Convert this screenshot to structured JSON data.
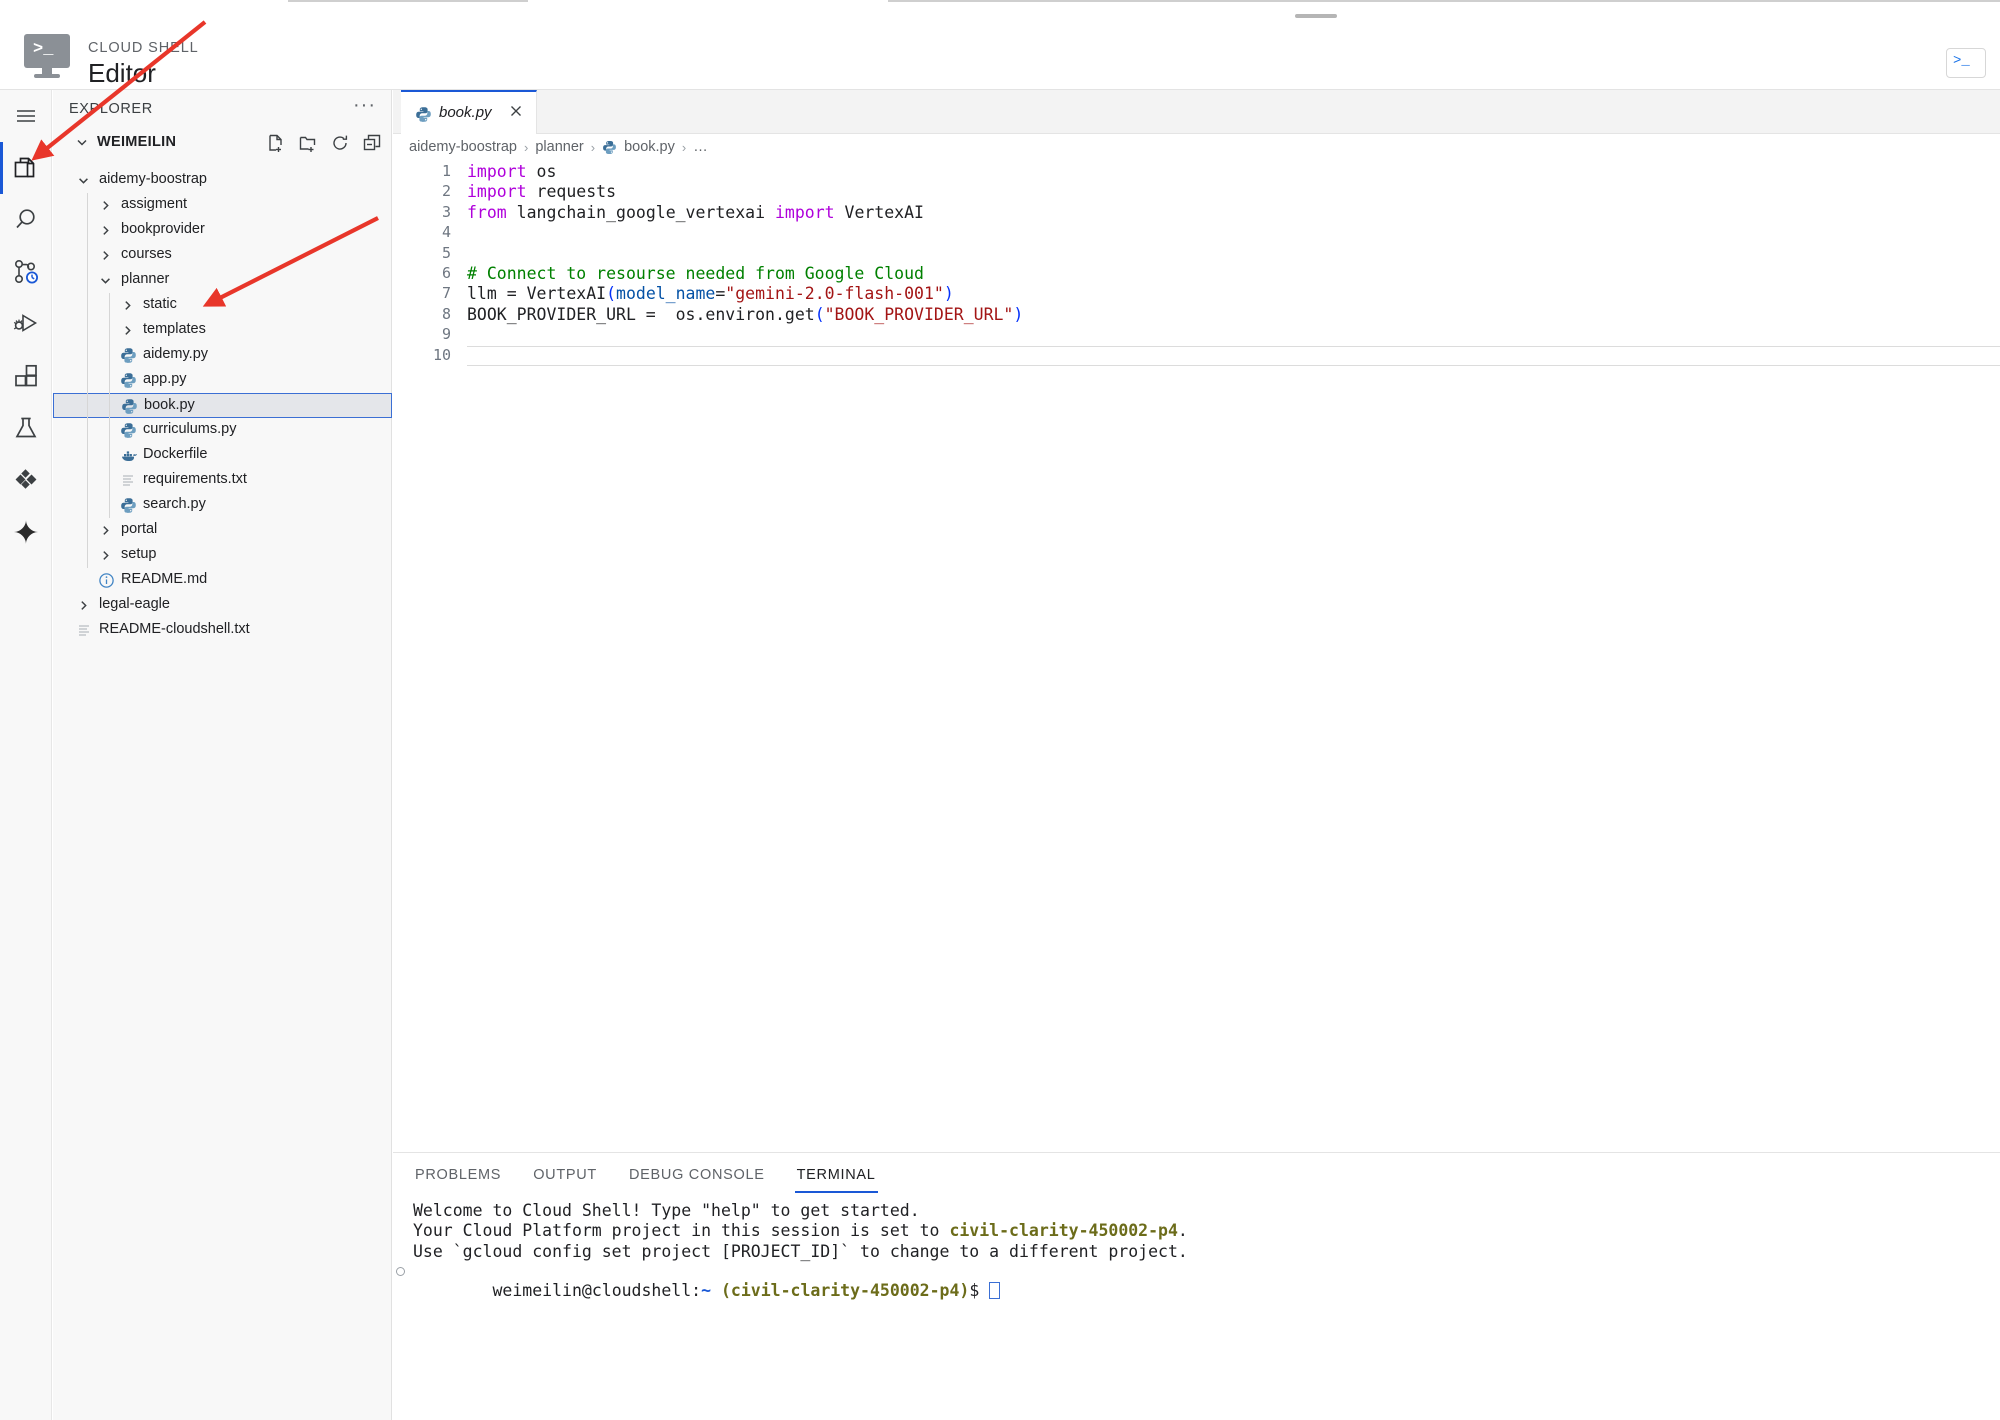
{
  "header": {
    "eyebrow": "CLOUD SHELL",
    "title": "Editor",
    "logo_icon": "cloud-shell-terminal-icon",
    "open_terminal_icon": "open-terminal-icon",
    "accent": "#1a58d6"
  },
  "activity_bar": {
    "items": [
      {
        "name": "menu-icon",
        "label": "Menu",
        "active": false
      },
      {
        "name": "explorer-icon",
        "label": "Explorer",
        "active": true
      },
      {
        "name": "search-icon",
        "label": "Search",
        "active": false
      },
      {
        "name": "source-control-icon",
        "label": "Source Control",
        "active": false,
        "badge": "clock"
      },
      {
        "name": "run-and-debug-icon",
        "label": "Run and Debug",
        "active": false
      },
      {
        "name": "extensions-icon",
        "label": "Extensions",
        "active": false
      },
      {
        "name": "testing-flask-icon",
        "label": "Testing",
        "active": false
      },
      {
        "name": "cloud-code-diamond-icon",
        "label": "Cloud Code",
        "active": false
      },
      {
        "name": "gemini-sparkle-icon",
        "label": "Gemini",
        "active": false
      }
    ]
  },
  "sidebar": {
    "title": "EXPLORER",
    "more_actions": "···",
    "root_label": "WEIMEILIN",
    "actions": [
      {
        "name": "new-file-icon",
        "label": "New File"
      },
      {
        "name": "new-folder-icon",
        "label": "New Folder"
      },
      {
        "name": "refresh-icon",
        "label": "Refresh Explorer"
      },
      {
        "name": "collapse-all-icon",
        "label": "Collapse Folders in Explorer"
      }
    ],
    "tree": [
      {
        "label": "aidemy-boostrap",
        "type": "folder",
        "state": "expanded",
        "depth": 0,
        "icon": "chevron-down-icon"
      },
      {
        "label": "assigment",
        "type": "folder",
        "state": "collapsed",
        "depth": 1,
        "icon": "chevron-right-icon"
      },
      {
        "label": "bookprovider",
        "type": "folder",
        "state": "collapsed",
        "depth": 1,
        "icon": "chevron-right-icon"
      },
      {
        "label": "courses",
        "type": "folder",
        "state": "collapsed",
        "depth": 1,
        "icon": "chevron-right-icon"
      },
      {
        "label": "planner",
        "type": "folder",
        "state": "expanded",
        "depth": 1,
        "icon": "chevron-down-icon"
      },
      {
        "label": "static",
        "type": "folder",
        "state": "collapsed",
        "depth": 2,
        "icon": "chevron-right-icon"
      },
      {
        "label": "templates",
        "type": "folder",
        "state": "collapsed",
        "depth": 2,
        "icon": "chevron-right-icon"
      },
      {
        "label": "aidemy.py",
        "type": "file",
        "depth": 2,
        "icon": "python-file-icon"
      },
      {
        "label": "app.py",
        "type": "file",
        "depth": 2,
        "icon": "python-file-icon"
      },
      {
        "label": "book.py",
        "type": "file",
        "depth": 2,
        "icon": "python-file-icon",
        "selected": true
      },
      {
        "label": "curriculums.py",
        "type": "file",
        "depth": 2,
        "icon": "python-file-icon"
      },
      {
        "label": "Dockerfile",
        "type": "file",
        "depth": 2,
        "icon": "docker-file-icon"
      },
      {
        "label": "requirements.txt",
        "type": "file",
        "depth": 2,
        "icon": "text-file-icon"
      },
      {
        "label": "search.py",
        "type": "file",
        "depth": 2,
        "icon": "python-file-icon"
      },
      {
        "label": "portal",
        "type": "folder",
        "state": "collapsed",
        "depth": 1,
        "icon": "chevron-right-icon"
      },
      {
        "label": "setup",
        "type": "folder",
        "state": "collapsed",
        "depth": 1,
        "icon": "chevron-right-icon"
      },
      {
        "label": "README.md",
        "type": "file",
        "depth": 1,
        "icon": "info-markdown-icon"
      },
      {
        "label": "legal-eagle",
        "type": "folder",
        "state": "collapsed",
        "depth": 0,
        "icon": "chevron-right-icon"
      },
      {
        "label": "README-cloudshell.txt",
        "type": "file",
        "depth": 0,
        "icon": "text-file-icon"
      }
    ]
  },
  "editor": {
    "tab": {
      "label": "book.py",
      "icon": "python-file-icon",
      "close_icon": "close-icon",
      "dirty": false
    },
    "breadcrumb": [
      {
        "label": "aidemy-boostrap",
        "icon": null
      },
      {
        "label": "planner",
        "icon": null
      },
      {
        "label": "book.py",
        "icon": "python-file-icon"
      },
      {
        "label": "…",
        "icon": null
      }
    ],
    "breadcrumb_separator": "›",
    "active_line": 10,
    "lines": [
      {
        "n": "1",
        "tokens": [
          {
            "t": "import",
            "c": "kw"
          },
          {
            "t": " os",
            "c": ""
          }
        ]
      },
      {
        "n": "2",
        "tokens": [
          {
            "t": "import",
            "c": "kw"
          },
          {
            "t": " requests",
            "c": ""
          }
        ]
      },
      {
        "n": "3",
        "tokens": [
          {
            "t": "from",
            "c": "kw"
          },
          {
            "t": " langchain_google_vertexai ",
            "c": ""
          },
          {
            "t": "import",
            "c": "kw"
          },
          {
            "t": " VertexAI",
            "c": ""
          }
        ]
      },
      {
        "n": "4",
        "tokens": []
      },
      {
        "n": "5",
        "tokens": []
      },
      {
        "n": "6",
        "tokens": [
          {
            "t": "# Connect to resourse needed from Google Cloud",
            "c": "cm"
          }
        ]
      },
      {
        "n": "7",
        "tokens": [
          {
            "t": "llm = VertexAI",
            "c": ""
          },
          {
            "t": "(",
            "c": "pn"
          },
          {
            "t": "model_name",
            "c": "pm"
          },
          {
            "t": "=",
            "c": ""
          },
          {
            "t": "\"gemini-2.0-flash-001\"",
            "c": "st"
          },
          {
            "t": ")",
            "c": "pn"
          }
        ]
      },
      {
        "n": "8",
        "tokens": [
          {
            "t": "BOOK_PROVIDER_URL =  os.environ.get",
            "c": ""
          },
          {
            "t": "(",
            "c": "pn"
          },
          {
            "t": "\"BOOK_PROVIDER_URL\"",
            "c": "st"
          },
          {
            "t": ")",
            "c": "pn"
          }
        ]
      },
      {
        "n": "9",
        "tokens": []
      },
      {
        "n": "10",
        "tokens": []
      }
    ]
  },
  "panel": {
    "tabs": [
      {
        "label": "PROBLEMS",
        "active": false
      },
      {
        "label": "OUTPUT",
        "active": false
      },
      {
        "label": "DEBUG CONSOLE",
        "active": false
      },
      {
        "label": "TERMINAL",
        "active": true
      }
    ],
    "terminal": {
      "line1": "Welcome to Cloud Shell! Type \"help\" to get started.",
      "line2_pre": "Your Cloud Platform project in this session is set to ",
      "line2_project": "civil-clarity-450002-p4",
      "line2_post": ".",
      "line3": "Use `gcloud config set project [PROJECT_ID]` to change to a different project.",
      "prompt_user": "weimeilin@cloudshell:",
      "prompt_tilde": "~",
      "prompt_project": " (civil-clarity-450002-p4)",
      "prompt_sigil": "$ "
    }
  },
  "annotations": [
    {
      "name": "arrow-to-explorer-icon",
      "label": "arrow pointing to Explorer activity bar icon",
      "color": "#e8362a"
    },
    {
      "name": "arrow-to-planner-folder",
      "label": "arrow pointing to planner folder",
      "color": "#e8362a"
    }
  ]
}
